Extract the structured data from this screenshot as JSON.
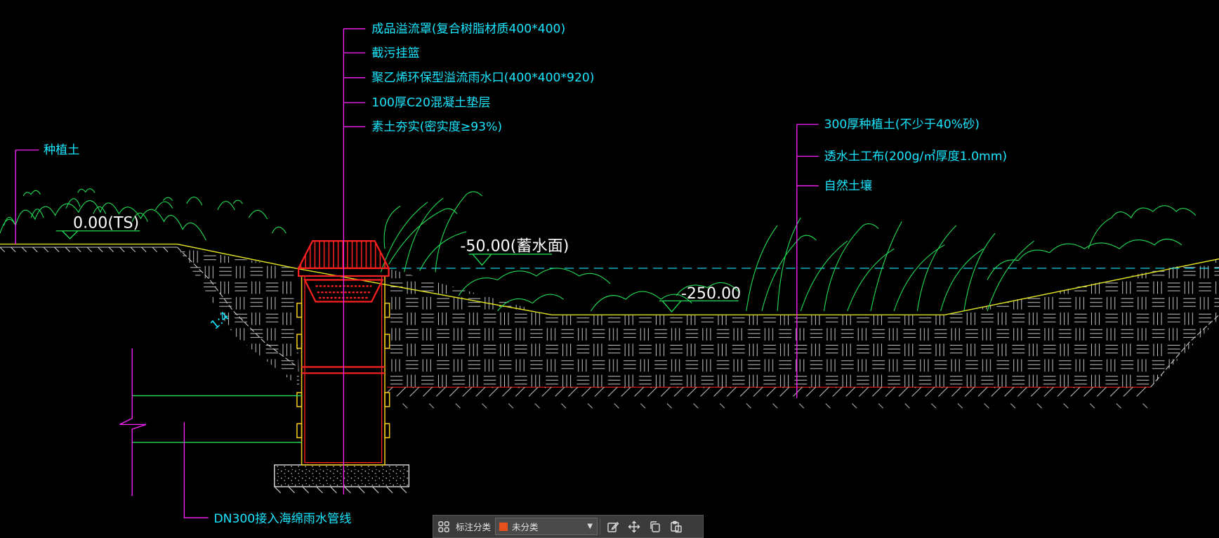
{
  "colors": {
    "background": "#000000",
    "annotation_text": "#19e6ff",
    "leader": "#ff22ff",
    "vegetation": "#22dd55",
    "hatch": "#c8c8c8",
    "ground_line": "#e0e020",
    "structure": "#ff2020",
    "structure_side": "#f0c820",
    "water_line": "#19e6ff",
    "elevation_text": "#ffffff",
    "category_swatch": "#e8501e"
  },
  "annotations_left": {
    "items": [
      "成品溢流罩(复合树脂材质400*400)",
      "截污挂篮",
      "聚乙烯环保型溢流雨水口(400*400*920)",
      "100厚C20混凝土垫层",
      "素土夯实(密实度≥93%)"
    ]
  },
  "annotations_right": {
    "items": [
      "300厚种植土(不少于40%砂)",
      "透水土工布(200g/㎡厚度1.0mm)",
      "自然土壤"
    ]
  },
  "planting_soil_label": "种植土",
  "pipe_label": "DN300接入海绵雨水管线",
  "elevations": {
    "top": "0.00(TS)",
    "storage": "-50.00(蓄水面)",
    "bottom": "-250.00"
  },
  "slope_left": "1:4",
  "toolbar": {
    "category_label": "标注分类",
    "category_value": "未分类",
    "icons": [
      "category-grid-icon",
      "edit-icon",
      "move-icon",
      "copy-icon",
      "paste-icon"
    ]
  }
}
